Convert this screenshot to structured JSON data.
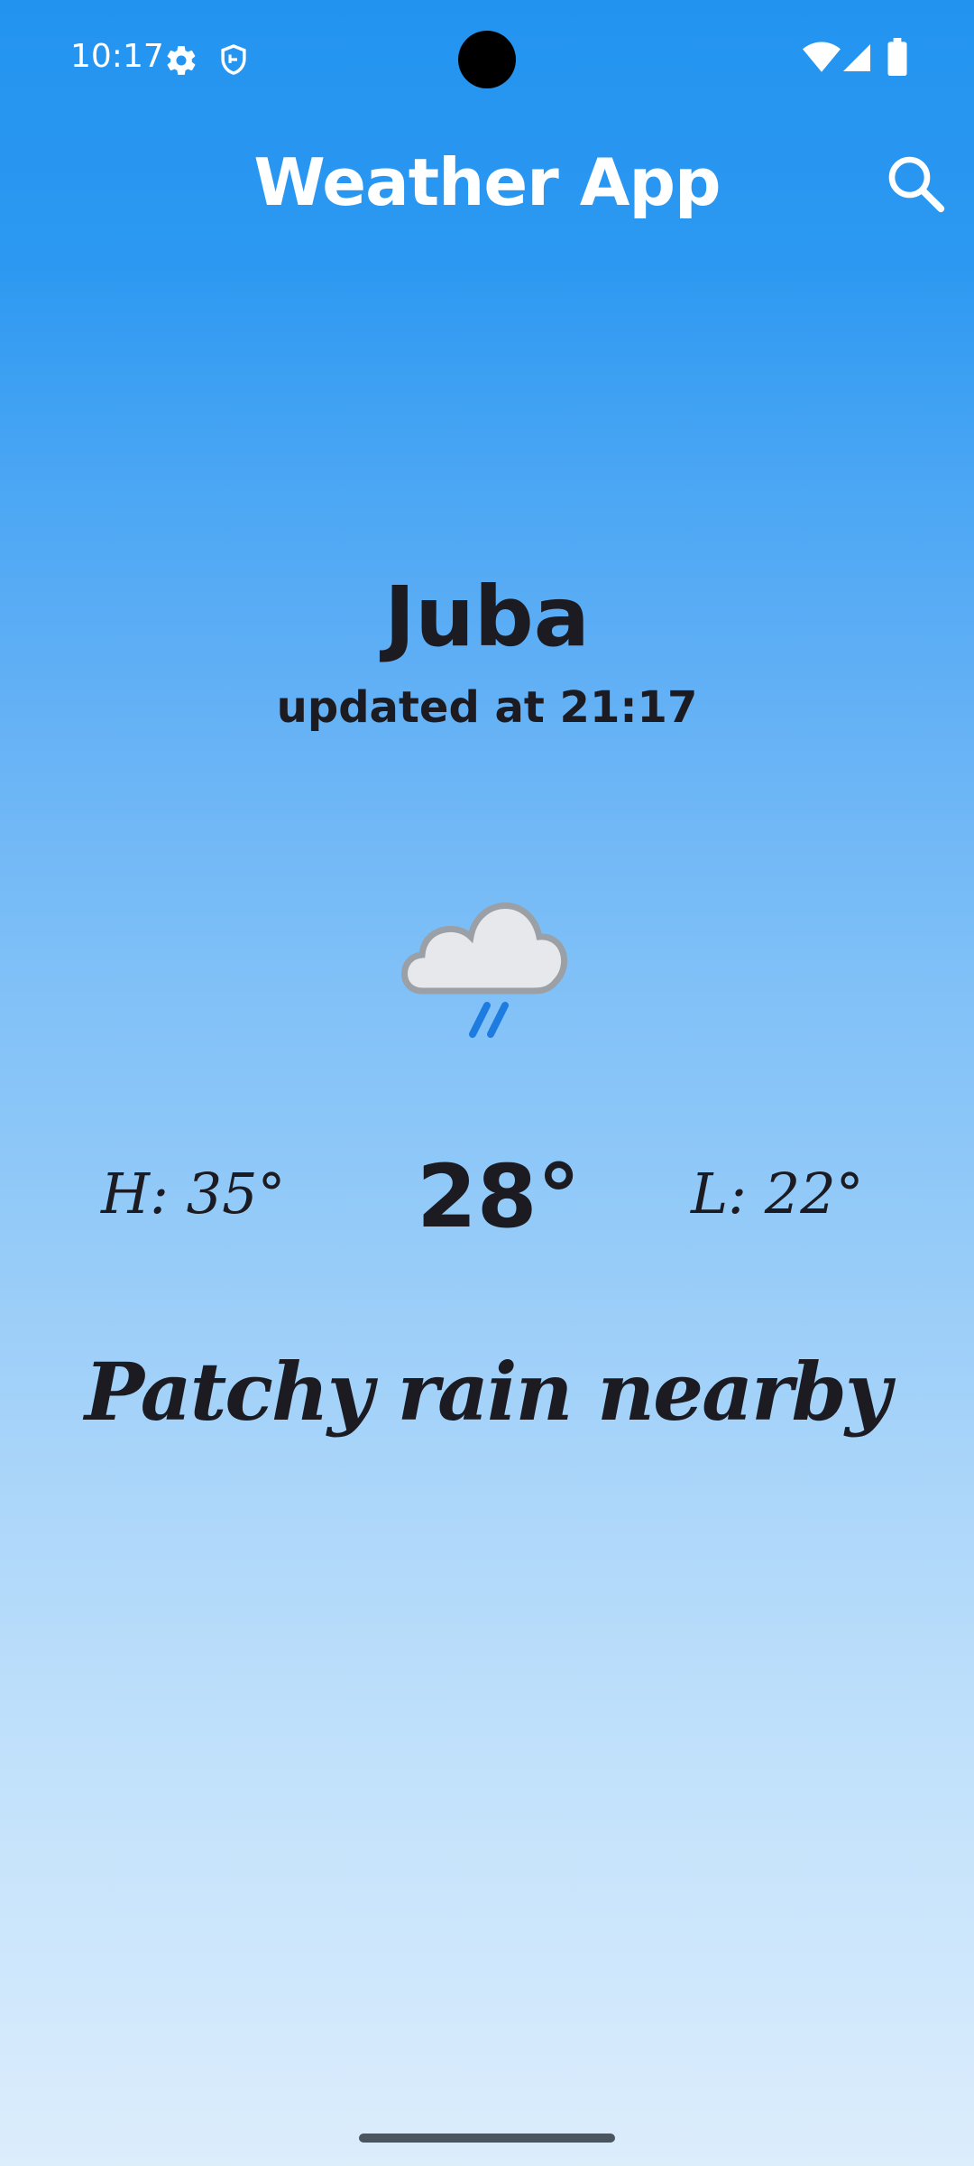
{
  "status_bar": {
    "time": "10:17",
    "icons": [
      "gear-icon",
      "shield-icon",
      "wifi-icon",
      "signal-icon",
      "battery-icon"
    ]
  },
  "app_bar": {
    "title": "Weather App",
    "search_icon": "search-icon"
  },
  "weather": {
    "city": "Juba",
    "updated": "updated at 21:17",
    "condition_icon": "moon-cloud-rain-icon",
    "high": "H: 35°",
    "current": "28°",
    "low": "L: 22°",
    "condition": "Patchy rain nearby"
  },
  "colors": {
    "gradient_top": "#2294f0",
    "gradient_bottom": "#dcedfc",
    "text_dark": "#1c1b21",
    "text_light": "#ffffff"
  }
}
